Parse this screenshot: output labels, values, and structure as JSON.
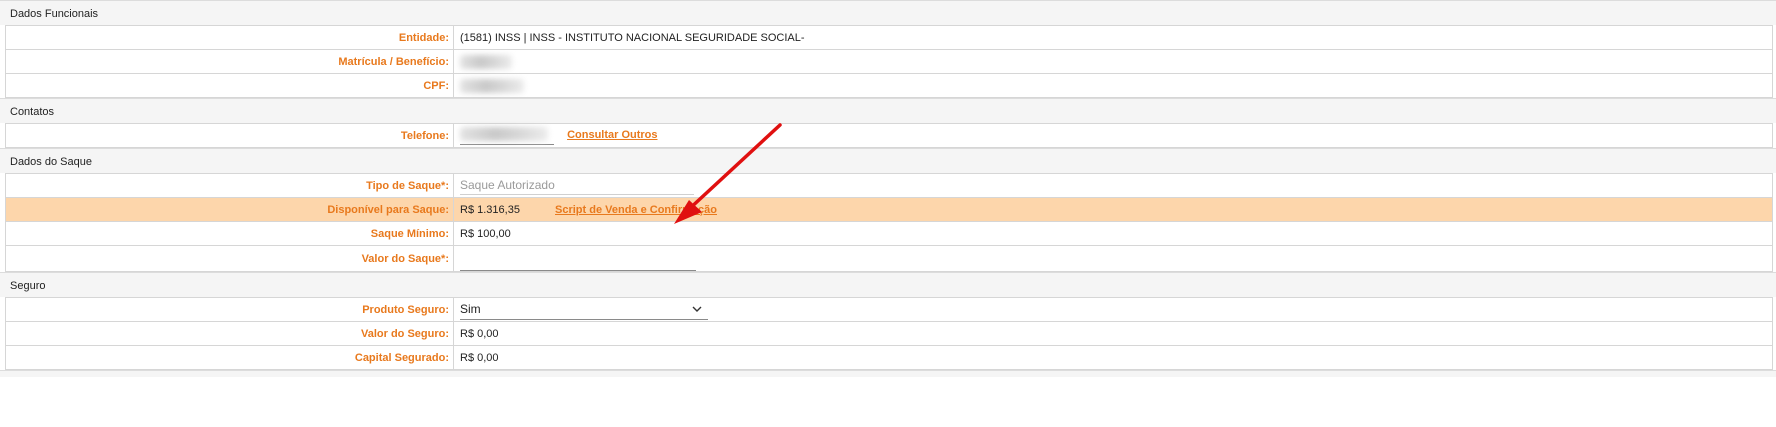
{
  "sections": {
    "funcionais": {
      "title": "Dados Funcionais",
      "entidade_label": "Entidade:",
      "entidade_value": "(1581) INSS | INSS - INSTITUTO NACIONAL SEGURIDADE SOCIAL-",
      "matricula_label": "Matrícula / Benefício:",
      "cpf_label": "CPF:"
    },
    "contatos": {
      "title": "Contatos",
      "telefone_label": "Telefone:",
      "consultar_link": "Consultar Outros"
    },
    "saque": {
      "title": "Dados do Saque",
      "tipo_label": "Tipo de Saque*:",
      "tipo_placeholder": "Saque Autorizado",
      "disponivel_label": "Disponível para Saque:",
      "disponivel_value": "R$ 1.316,35",
      "script_link": "Script de Venda e Confirmação",
      "minimo_label": "Saque Mínimo:",
      "minimo_value": "R$ 100,00",
      "valor_label": "Valor do Saque*:",
      "valor_value": ""
    },
    "seguro": {
      "title": "Seguro",
      "produto_label": "Produto Seguro:",
      "produto_selected": "Sim",
      "valor_label": "Valor do Seguro:",
      "valor_value": "R$ 0,00",
      "capital_label": "Capital Segurado:",
      "capital_value": "R$ 0,00"
    }
  },
  "colors": {
    "label_orange": "#e8791d",
    "highlight_row": "#fdd6ab",
    "annotation_arrow": "#e01010"
  },
  "icons": {
    "select_chevron": "chevron-down-icon",
    "annotation": "red-arrow-annotation"
  }
}
